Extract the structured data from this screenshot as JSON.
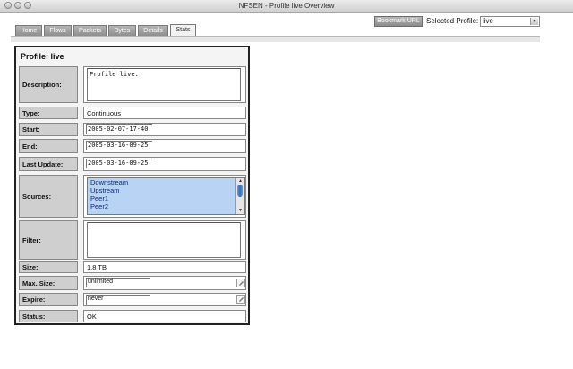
{
  "window": {
    "title": "NFSEN - Profile live Overview"
  },
  "tabs": [
    {
      "label": "Home"
    },
    {
      "label": "Flows"
    },
    {
      "label": "Packets"
    },
    {
      "label": "Bytes"
    },
    {
      "label": "Details"
    },
    {
      "label": "Stats",
      "active": true
    }
  ],
  "header": {
    "bookmark_label": "Bookmark URL",
    "profile_label": "Selected Profile:",
    "profile_value": "live"
  },
  "panel": {
    "title": "Profile: live",
    "description_label": "Description:",
    "description_value": "Profile live.",
    "type_label": "Type:",
    "type_value": "Continuous",
    "start_label": "Start:",
    "start_value": "2005-02-07-17-40",
    "end_label": "End:",
    "end_value": "2005-03-16-09-25",
    "last_update_label": "Last Update:",
    "last_update_value": "2005-03-16-09-25",
    "sources_label": "Sources:",
    "sources": [
      "Downstream",
      "Upstream",
      "Peer1",
      "Peer2"
    ],
    "filter_label": "Filter:",
    "filter_value": "",
    "size_label": "Size:",
    "size_value": "1.8 TB",
    "max_size_label": "Max. Size:",
    "max_size_value": "unlimited",
    "expire_label": "Expire:",
    "expire_value": "never",
    "status_label": "Status:",
    "status_value": "OK"
  },
  "icons": {
    "edit": "pencil-edit-icon"
  }
}
